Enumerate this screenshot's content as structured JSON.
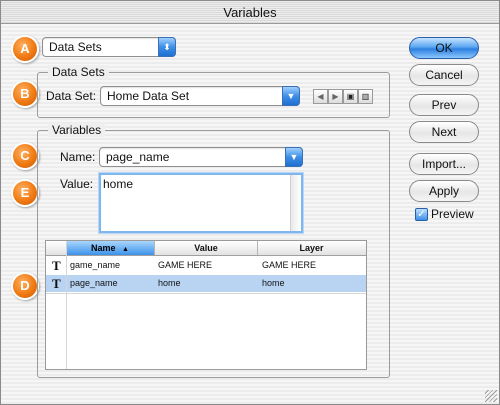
{
  "window": {
    "title": "Variables"
  },
  "callouts": {
    "a": "A",
    "b": "B",
    "c": "C",
    "d": "D",
    "e": "E"
  },
  "top_popup": {
    "value": "Data Sets"
  },
  "datasets_group": {
    "label": "Data Sets",
    "field_label": "Data Set:",
    "value": "Home Data Set",
    "nav_icons": [
      "prev-arrow-icon",
      "next-arrow-icon",
      "save-icon",
      "trash-icon"
    ]
  },
  "variables_group": {
    "label": "Variables",
    "name_label": "Name:",
    "name_value": "page_name",
    "value_label": "Value:",
    "value_text": "home"
  },
  "table": {
    "columns": [
      "Name",
      "Value",
      "Layer"
    ],
    "sort_indicator": "▲",
    "rows": [
      {
        "icon": "T",
        "name": "game_name",
        "value": "GAME HERE",
        "layer": "GAME HERE",
        "selected": false
      },
      {
        "icon": "T",
        "name": "page_name",
        "value": "home",
        "layer": "home",
        "selected": true
      }
    ]
  },
  "buttons": {
    "ok": "OK",
    "cancel": "Cancel",
    "prev": "Prev",
    "next": "Next",
    "import": "Import...",
    "apply": "Apply"
  },
  "preview": {
    "label": "Preview",
    "checked": true
  },
  "colors": {
    "accent": "#3e8fe6",
    "callout": "#f07a12",
    "selection": "#b8d4f2"
  }
}
